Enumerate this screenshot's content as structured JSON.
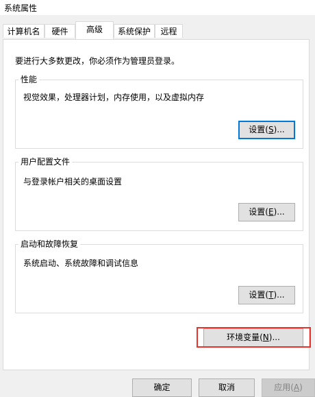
{
  "window": {
    "title": "系统属性"
  },
  "tabs": [
    {
      "label": "计算机名",
      "active": false
    },
    {
      "label": "硬件",
      "active": false
    },
    {
      "label": "高级",
      "active": true
    },
    {
      "label": "系统保护",
      "active": false
    },
    {
      "label": "远程",
      "active": false
    }
  ],
  "advanced": {
    "admin_note": "要进行大多数更改，你必须作为管理员登录。",
    "performance": {
      "legend": "性能",
      "description": "视觉效果，处理器计划，内存使用，以及虚拟内存",
      "button_text": "设置(",
      "button_accel": "S",
      "button_suffix": ")..."
    },
    "user_profiles": {
      "legend": "用户配置文件",
      "description": "与登录帐户相关的桌面设置",
      "button_text": "设置(",
      "button_accel": "E",
      "button_suffix": ")..."
    },
    "startup_recovery": {
      "legend": "启动和故障恢复",
      "description": "系统启动、系统故障和调试信息",
      "button_text": "设置(",
      "button_accel": "T",
      "button_suffix": ")..."
    },
    "env_vars": {
      "button_text": "环境变量(",
      "button_accel": "N",
      "button_suffix": ")..."
    }
  },
  "footer": {
    "ok_label": "确定",
    "cancel_label": "取消",
    "apply_text": "应用(",
    "apply_accel": "A",
    "apply_suffix": ")"
  },
  "colors": {
    "highlight": "#e8332d",
    "focus": "#0078d7"
  }
}
